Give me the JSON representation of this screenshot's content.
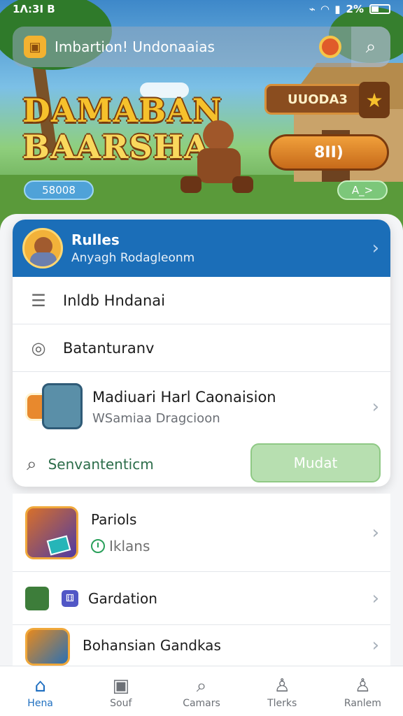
{
  "status_bar": {
    "time": "1Λ:3Ι Β",
    "battery": "2%",
    "signal_icons": [
      "nfc-icon",
      "wifi-icon",
      "signal-icon",
      "battery-icon"
    ]
  },
  "search": {
    "placeholder": "Imbartion! Undonaaias",
    "search_icon": "search-icon",
    "notification_icon": "notification-badge-icon"
  },
  "hero": {
    "game_title_line1": "DAMABAN",
    "game_title_line2": "BAARSHA",
    "plank_label": "UUODA3",
    "orange_button_label": "8ΙΙ)",
    "pill_left": "58008",
    "pill_right": "A_>"
  },
  "card": {
    "header_title": "Rulles",
    "header_subtitle": "Anyagh Rodagleonm",
    "items": [
      {
        "label": "Inldb Hndanai",
        "icon": "list-icon"
      },
      {
        "label": "Batanturanv",
        "icon": "camera-icon"
      }
    ],
    "game": {
      "title": "Madiuari Harl Caonaision",
      "subtitle": "WSamiaa Dragcioon"
    },
    "search_row_label": "Senvantenticm",
    "action_button": "Mudat"
  },
  "list": [
    {
      "title": "Pariols",
      "subtitle": "Iklans"
    },
    {
      "title": "Gardation"
    },
    {
      "title": "Bohansian Gandkas"
    }
  ],
  "bottom_nav": [
    {
      "label": "Hena",
      "icon": "home-icon",
      "active": true
    },
    {
      "label": "Souf",
      "icon": "picture-icon",
      "active": false
    },
    {
      "label": "Camars",
      "icon": "search-icon",
      "active": false
    },
    {
      "label": "Tlerks",
      "icon": "people-icon",
      "active": false
    },
    {
      "label": "Ranlem",
      "icon": "profile-icon",
      "active": false
    }
  ],
  "colors": {
    "primary": "#1b6eb8",
    "accent_green": "#b7dfb0",
    "title_gold": "#f6c12c"
  }
}
